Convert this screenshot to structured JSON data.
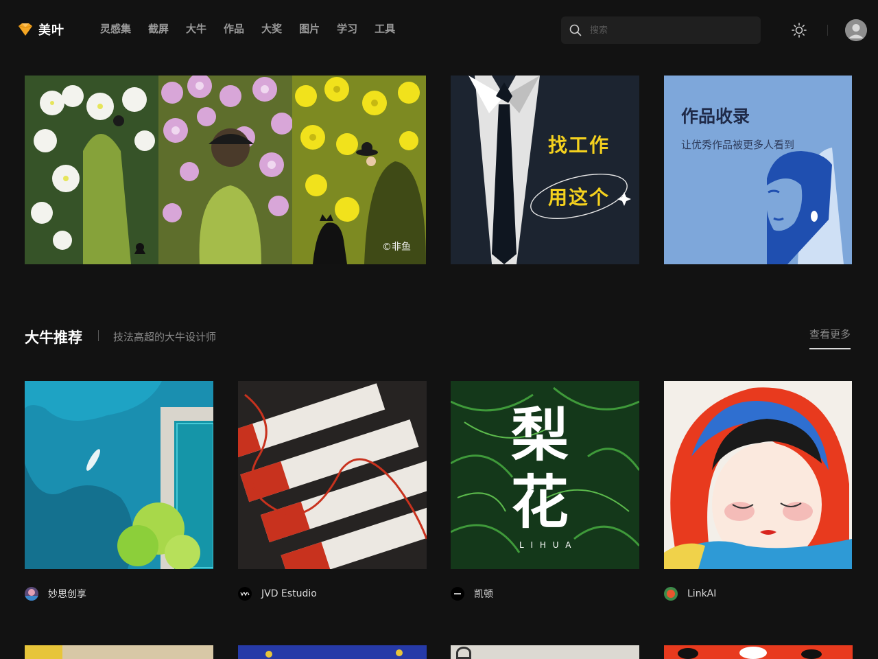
{
  "header": {
    "logo_text": "美叶",
    "nav": [
      "灵感集",
      "截屏",
      "大牛",
      "作品",
      "大奖",
      "图片",
      "学习",
      "工具"
    ],
    "search_placeholder": "搜索"
  },
  "banners": {
    "main_credit": "©非鱼",
    "job": {
      "line1": "找工作",
      "line2": "用这个"
    },
    "collect": {
      "title": "作品收录",
      "subtitle": "让优秀作品被更多人看到"
    }
  },
  "section": {
    "title": "大牛推荐",
    "subtitle": "技法高超的大牛设计师",
    "more": "查看更多"
  },
  "cards": [
    {
      "name": "妙思创享"
    },
    {
      "name": "JVD Estudio"
    },
    {
      "name": "凯顿",
      "overlay_title": "梨花",
      "overlay_sub": "L I H U A"
    },
    {
      "name": "LinkAI"
    }
  ],
  "colors": {
    "brand": "#f5a623",
    "accent_yellow": "#f4d11e",
    "background": "#121212"
  }
}
